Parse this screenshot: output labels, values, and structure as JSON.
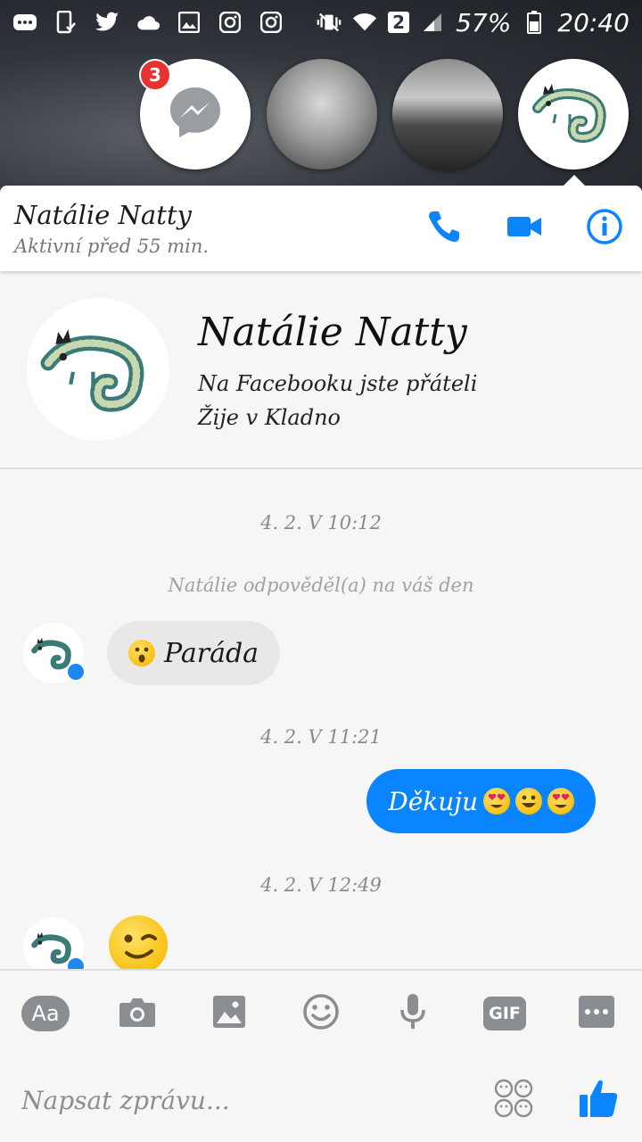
{
  "status_bar": {
    "icons_left": [
      "more-icon",
      "phone-check-icon",
      "twitter-icon",
      "cloud-icon",
      "image-icon",
      "instagram-icon",
      "instagram-icon"
    ],
    "icons_right": [
      "vibrate-icon",
      "wifi-icon",
      "signal-icon",
      "battery-icon"
    ],
    "sim_slot": "2",
    "battery": "57%",
    "time": "20:40"
  },
  "chat_heads": {
    "messenger_unread_count": "3",
    "heads": [
      "messenger",
      "contact-photo",
      "contact-photo",
      "chameleon-avatar"
    ]
  },
  "header": {
    "name": "Natálie Natty",
    "status": "Aktivní před 55 min.",
    "actions": [
      "phone-icon",
      "video-icon",
      "info-icon"
    ]
  },
  "profile": {
    "name": "Natálie Natty",
    "line1": "Na Facebooku jste přáteli",
    "line2": "Žije v Kladno"
  },
  "messages": {
    "ts1": "4. 2. V 10:12",
    "system_note": "Natálie odpověděl(a) na váš den",
    "incoming1": "Paráda",
    "ts2": "4. 2. V 11:21",
    "outgoing1": "Děkuju",
    "ts3": "4. 2. V 12:49"
  },
  "composer": {
    "aa_label": "Aa",
    "tools": [
      "aa",
      "camera-icon",
      "image-icon",
      "emoji-icon",
      "microphone-icon",
      "gif-icon",
      "more-icon"
    ],
    "gif_label": "GIF",
    "placeholder": "Napsat zprávu..."
  },
  "colors": {
    "accent": "#0a84ff",
    "bubble_in": "#e8e8e8",
    "badge": "#e8322f"
  }
}
